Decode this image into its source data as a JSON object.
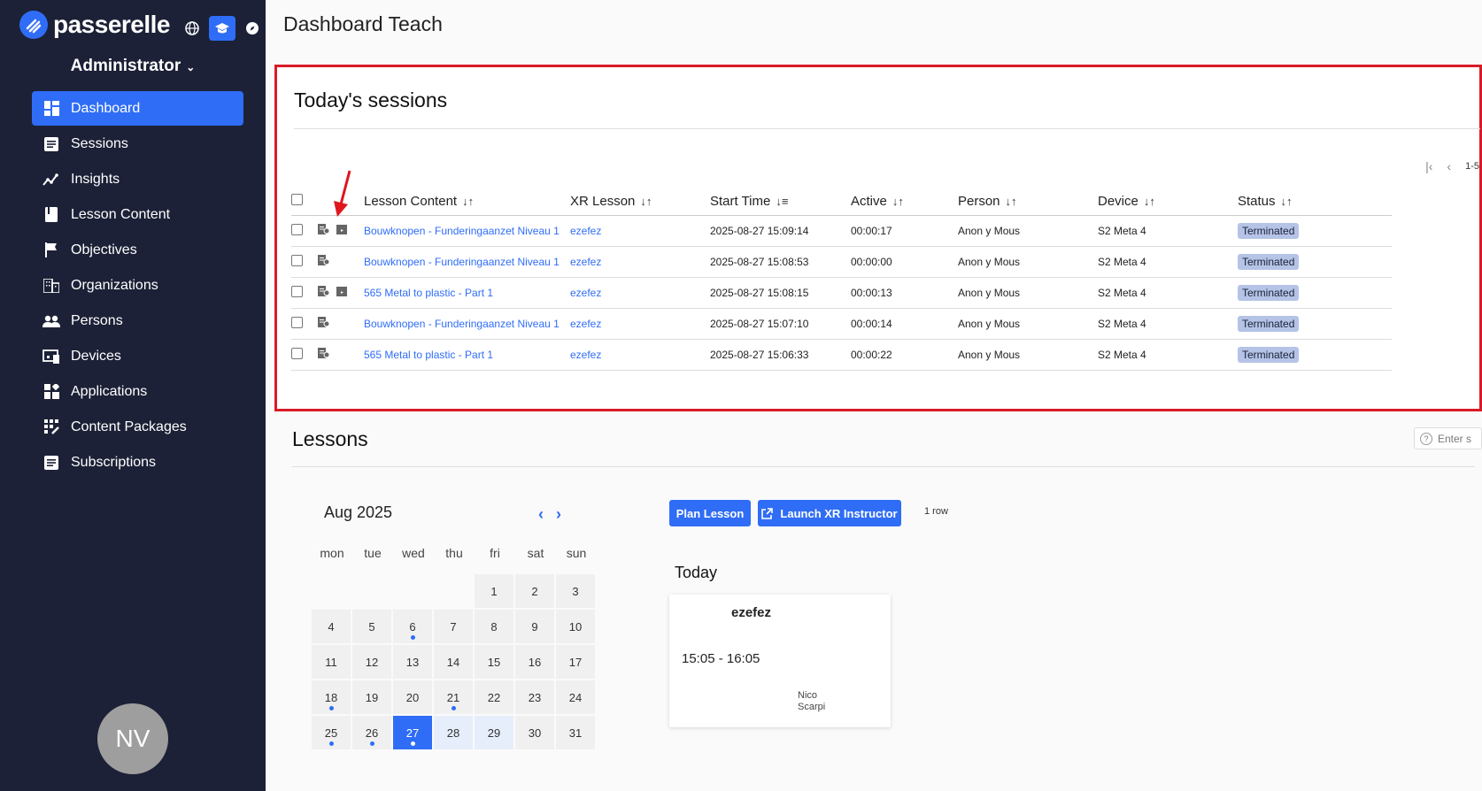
{
  "sidebar": {
    "brand": "passerelle",
    "role": "Administrator",
    "items": [
      {
        "label": "Dashboard",
        "icon": "dashboard-icon"
      },
      {
        "label": "Sessions",
        "icon": "sessions-icon"
      },
      {
        "label": "Insights",
        "icon": "insights-icon"
      },
      {
        "label": "Lesson Content",
        "icon": "lesson-content-icon"
      },
      {
        "label": "Objectives",
        "icon": "flag-icon"
      },
      {
        "label": "Organizations",
        "icon": "building-icon"
      },
      {
        "label": "Persons",
        "icon": "people-icon"
      },
      {
        "label": "Devices",
        "icon": "devices-icon"
      },
      {
        "label": "Applications",
        "icon": "apps-icon"
      },
      {
        "label": "Content Packages",
        "icon": "packages-icon"
      },
      {
        "label": "Subscriptions",
        "icon": "subscriptions-icon"
      }
    ],
    "avatar": "NV"
  },
  "page_title": "Dashboard Teach",
  "sessions": {
    "title": "Today's sessions",
    "pager_count": "1-5",
    "columns": [
      "Lesson Content",
      "XR Lesson",
      "Start Time",
      "Active",
      "Person",
      "Device",
      "Status"
    ],
    "rows": [
      {
        "lesson": "Bouwknopen - Funderingaanzet Niveau 1",
        "xr": "ezefez",
        "start": "2025-08-27 15:09:14",
        "active": "00:00:17",
        "person": "Anon y Mous",
        "device": "S2 Meta 4",
        "status": "Terminated",
        "replay": true
      },
      {
        "lesson": "Bouwknopen - Funderingaanzet Niveau 1",
        "xr": "ezefez",
        "start": "2025-08-27 15:08:53",
        "active": "00:00:00",
        "person": "Anon y Mous",
        "device": "S2 Meta 4",
        "status": "Terminated",
        "replay": false
      },
      {
        "lesson": "565 Metal to plastic - Part 1",
        "xr": "ezefez",
        "start": "2025-08-27 15:08:15",
        "active": "00:00:13",
        "person": "Anon y Mous",
        "device": "S2 Meta 4",
        "status": "Terminated",
        "replay": true
      },
      {
        "lesson": "Bouwknopen - Funderingaanzet Niveau 1",
        "xr": "ezefez",
        "start": "2025-08-27 15:07:10",
        "active": "00:00:14",
        "person": "Anon y Mous",
        "device": "S2 Meta 4",
        "status": "Terminated",
        "replay": false
      },
      {
        "lesson": "565 Metal to plastic - Part 1",
        "xr": "ezefez",
        "start": "2025-08-27 15:06:33",
        "active": "00:00:22",
        "person": "Anon y Mous",
        "device": "S2 Meta 4",
        "status": "Terminated",
        "replay": false
      }
    ]
  },
  "lessons": {
    "title": "Lessons",
    "search_placeholder": "Enter s",
    "calendar": {
      "month": "Aug 2025",
      "weekdays": [
        "mon",
        "tue",
        "wed",
        "thu",
        "fri",
        "sat",
        "sun"
      ],
      "leading_blanks": 4,
      "days": 31,
      "today": 27,
      "highlighted": [
        28,
        29
      ],
      "dots": [
        6,
        18,
        21,
        25,
        26,
        27
      ]
    },
    "plan_button": "Plan Lesson",
    "launch_button": "Launch XR Instructor",
    "row_count": "1 row",
    "today_label": "Today",
    "card": {
      "title": "ezefez",
      "time": "15:05 - 16:05",
      "person_first": "Nico",
      "person_last": "Scarpi"
    }
  },
  "colors": {
    "accent": "#2f6df6",
    "sidebar_bg": "#1c2137",
    "highlight_border": "#d81b27",
    "badge_bg": "#b4c3e6"
  }
}
